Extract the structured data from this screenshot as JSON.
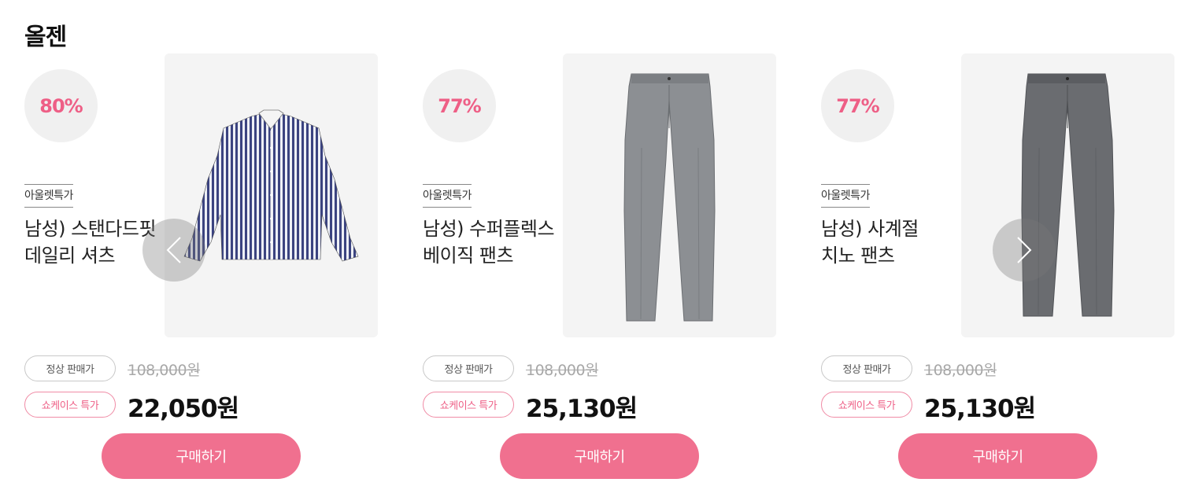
{
  "brand": {
    "title": "올젠"
  },
  "products": [
    {
      "discount": "80%",
      "tag": "아울렛특가",
      "name": "남성) 스탠다드핏\n데일리 셔츠",
      "regular_label": "정상 판매가",
      "original_price": "108,000원",
      "special_label": "쇼케이스 특가",
      "sale_price": "22,050원",
      "buy_label": "구매하기",
      "image": "striped-shirt"
    },
    {
      "discount": "77%",
      "tag": "아울렛특가",
      "name": "남성) 수퍼플렉스\n베이직 팬츠",
      "regular_label": "정상 판매가",
      "original_price": "108,000원",
      "special_label": "쇼케이스 특가",
      "sale_price": "25,130원",
      "buy_label": "구매하기",
      "image": "light-gray-pants"
    },
    {
      "discount": "77%",
      "tag": "아울렛특가",
      "name": "남성) 사계절\n치노 팬츠",
      "regular_label": "정상 판매가",
      "original_price": "108,000원",
      "special_label": "쇼케이스 특가",
      "sale_price": "25,130원",
      "buy_label": "구매하기",
      "image": "dark-gray-pants"
    }
  ],
  "carousel": {
    "prev_icon": "chevron-left-icon",
    "next_icon": "chevron-right-icon"
  },
  "colors": {
    "accent": "#f0708f",
    "discount_text": "#ee5f86",
    "image_bg": "#f4f4f4"
  }
}
